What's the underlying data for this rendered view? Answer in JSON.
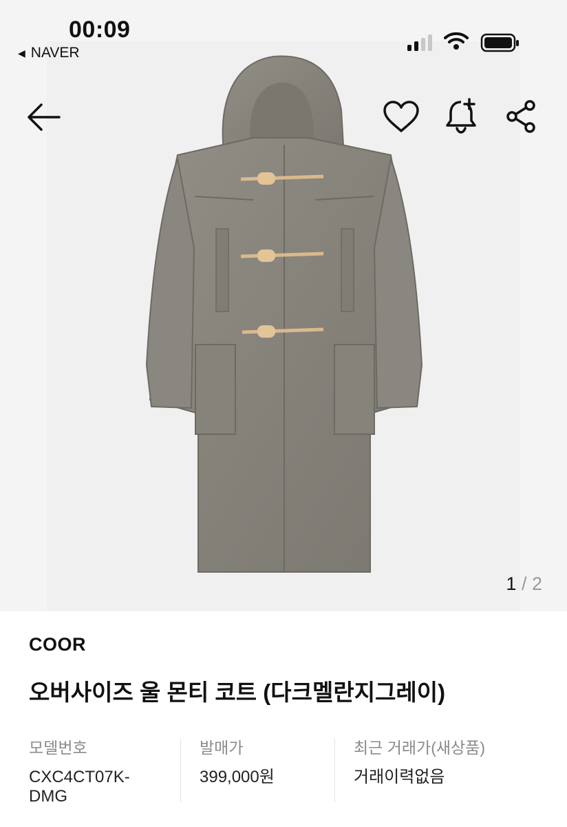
{
  "status_bar": {
    "time": "00:09",
    "back_app_label": "NAVER",
    "back_arrow_glyph": "◀"
  },
  "toolbar": {
    "back_icon": "arrow-left-icon",
    "wish_icon": "heart-icon",
    "alert_icon": "bell-plus-icon",
    "share_icon": "share-icon"
  },
  "gallery": {
    "current": "1",
    "separator": "/",
    "total": "2"
  },
  "product": {
    "brand": "COOR",
    "title": "오버사이즈 울 몬티 코트 (다크멜란지그레이)"
  },
  "specs": [
    {
      "label": "모델번호",
      "value": "CXC4CT07K-\nDMG"
    },
    {
      "label": "발매가",
      "value": "399,000원"
    },
    {
      "label": "최근 거래가(새상품)",
      "value": "거래이력없음"
    }
  ],
  "colors": {
    "coat": "#8b8880",
    "toggle": "#d9b98c",
    "background": "#f4f4f4"
  }
}
